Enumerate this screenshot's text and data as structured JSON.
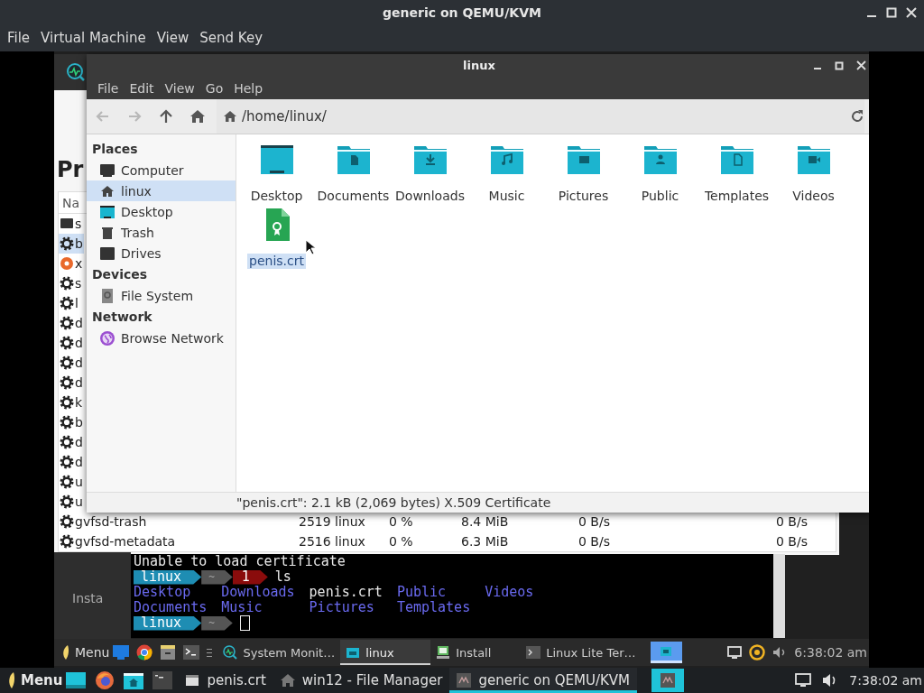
{
  "host_window": {
    "title": "generic on QEMU/KVM",
    "menu": [
      "File",
      "Virtual Machine",
      "View",
      "Send Key"
    ]
  },
  "guest": {
    "system_monitor": {
      "heading": "Pr",
      "column_1": "Na",
      "rows": [
        {
          "name": "s",
          "kind": "screen",
          "selected": false
        },
        {
          "name": "b",
          "kind": "gear",
          "selected": true
        },
        {
          "name": "x",
          "kind": "app",
          "selected": false
        },
        {
          "name": "s",
          "kind": "gear",
          "selected": false
        },
        {
          "name": "l",
          "kind": "gear",
          "selected": false
        },
        {
          "name": "d",
          "kind": "gear",
          "selected": false
        },
        {
          "name": "d",
          "kind": "gear",
          "selected": false
        },
        {
          "name": "d",
          "kind": "gear",
          "selected": false
        },
        {
          "name": "d",
          "kind": "gear",
          "selected": false
        },
        {
          "name": "k",
          "kind": "gear",
          "selected": false
        },
        {
          "name": "b",
          "kind": "gear",
          "selected": false
        },
        {
          "name": "d",
          "kind": "gear",
          "selected": false
        },
        {
          "name": "d",
          "kind": "gear",
          "selected": false
        },
        {
          "name": "u",
          "kind": "gear",
          "selected": false
        },
        {
          "name": "u",
          "kind": "gear",
          "selected": false
        },
        {
          "name": "gvfsd-trash",
          "kind": "gear",
          "selected": false,
          "cells": [
            "2519",
            "linux",
            "0 %",
            "8.4 MiB",
            "0 B/s",
            "0 B/s"
          ]
        },
        {
          "name": "gvfsd-metadata",
          "kind": "gear",
          "selected": false,
          "cells": [
            "2516",
            "linux",
            "0 %",
            "6.3 MiB",
            "0 B/s",
            "0 B/s"
          ]
        }
      ]
    },
    "file_manager": {
      "title": "linux",
      "menu": [
        "File",
        "Edit",
        "View",
        "Go",
        "Help"
      ],
      "toolbar": [
        {
          "kind": "back",
          "disabled": true
        },
        {
          "kind": "forward",
          "disabled": true
        },
        {
          "kind": "up",
          "disabled": false
        },
        {
          "kind": "home",
          "disabled": false
        }
      ],
      "path": "/home/linux/",
      "sidebar": [
        {
          "heading": "Places",
          "items": [
            {
              "label": "Computer",
              "kind": "computer",
              "selected": false
            },
            {
              "label": "linux",
              "kind": "home",
              "selected": true
            },
            {
              "label": "Desktop",
              "kind": "desktop",
              "selected": false
            },
            {
              "label": "Trash",
              "kind": "trash",
              "selected": false
            },
            {
              "label": "Drives",
              "kind": "drive",
              "selected": false
            }
          ]
        },
        {
          "heading": "Devices",
          "items": [
            {
              "label": "File System",
              "kind": "disk",
              "selected": false
            }
          ]
        },
        {
          "heading": "Network",
          "items": [
            {
              "label": "Browse Network",
              "kind": "network",
              "selected": false
            }
          ]
        }
      ],
      "files": [
        {
          "name": "Desktop",
          "kind": "desktop",
          "selected": false
        },
        {
          "name": "Documents",
          "kind": "documents",
          "selected": false
        },
        {
          "name": "Downloads",
          "kind": "downloads",
          "selected": false
        },
        {
          "name": "Music",
          "kind": "music",
          "selected": false
        },
        {
          "name": "Pictures",
          "kind": "pictures",
          "selected": false
        },
        {
          "name": "Public",
          "kind": "public",
          "selected": false
        },
        {
          "name": "Templates",
          "kind": "templates",
          "selected": false
        },
        {
          "name": "Videos",
          "kind": "videos",
          "selected": false
        },
        {
          "name": "penis.crt",
          "kind": "certificate",
          "selected": true
        }
      ],
      "status": "\"penis.crt\": 2.1 kB (2,069 bytes) X.509 Certificate"
    },
    "install_window": {
      "label": "Insta"
    },
    "terminal": {
      "lines": [
        {
          "kind": "text",
          "text": "Unable to load certificate"
        },
        {
          "kind": "prompt",
          "user": "linux",
          "dir": "~",
          "status": "1",
          "command": "ls"
        },
        {
          "kind": "listing",
          "entries": [
            {
              "name": "Desktop",
              "directory": true
            },
            {
              "name": "Downloads",
              "directory": true
            },
            {
              "name": "penis.crt",
              "directory": false
            },
            {
              "name": "Public",
              "directory": true
            },
            {
              "name": "Videos",
              "directory": true
            }
          ]
        },
        {
          "kind": "listing",
          "entries": [
            {
              "name": "Documents",
              "directory": true
            },
            {
              "name": "Music",
              "directory": true
            },
            {
              "name": "Pictures",
              "directory": true
            },
            {
              "name": "Templates",
              "directory": true
            }
          ]
        },
        {
          "kind": "prompt",
          "user": "linux",
          "dir": "~",
          "cursor": true
        }
      ]
    },
    "taskbar": {
      "menu": "Menu",
      "tasks": [
        {
          "label": "System Monit…",
          "kind": "monitor",
          "selected": false
        },
        {
          "label": "linux",
          "kind": "folder",
          "selected": true
        },
        {
          "label": "Install",
          "kind": "install",
          "selected": false
        },
        {
          "label": "Linux Lite Ter…",
          "kind": "terminal",
          "selected": false
        }
      ],
      "clock": "6:38:02 am"
    }
  },
  "host_taskbar": {
    "menu": "Menu",
    "tasks": [
      {
        "label": "penis.crt",
        "kind": "document",
        "selected": false
      },
      {
        "label": "win12 - File Manager",
        "kind": "home",
        "selected": false
      },
      {
        "label": "generic on QEMU/KVM",
        "kind": "vm",
        "selected": true
      }
    ],
    "clock": "7:38:02 am"
  }
}
